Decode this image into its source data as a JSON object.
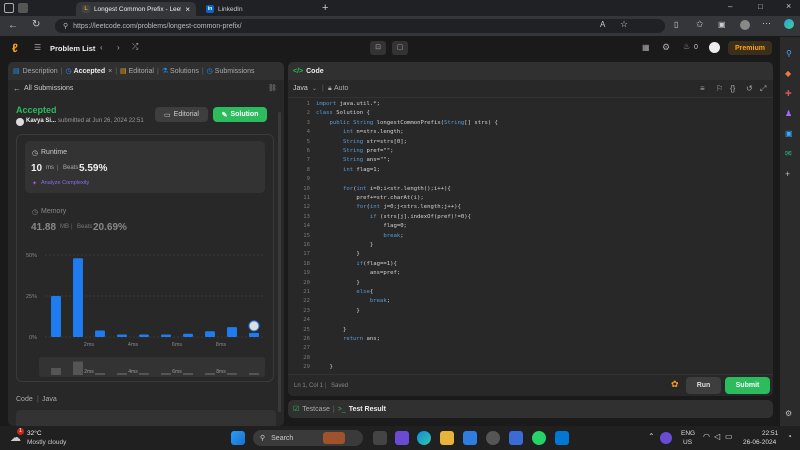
{
  "browser": {
    "tabs": [
      {
        "label": "Longest Common Prefix - LeetCo",
        "close": "×"
      },
      {
        "label": "LinkedIn"
      }
    ],
    "new_tab": "+",
    "url": "https://leetcode.com/problems/longest-common-prefix/",
    "window_controls": [
      "–",
      "□",
      "×"
    ]
  },
  "nav": {
    "problem_list": "Problem List",
    "premium": "Premium",
    "streak": "0"
  },
  "left": {
    "tabs": [
      "Description",
      "Accepted",
      "Editorial",
      "Solutions",
      "Submissions"
    ],
    "all_submissions": "All Submissions",
    "status": "Accepted",
    "user": "Kavya Si...",
    "submitted_at": "submitted at Jun 26, 2024 22:51",
    "editorial_btn": "Editorial",
    "solution_btn": "Solution",
    "runtime_title": "Runtime",
    "runtime_value": "10",
    "runtime_unit": "ms",
    "beats_label": "Beats",
    "runtime_beats": "5.59%",
    "analyze": "Analyze Complexity",
    "memory_title": "Memory",
    "memory_value": "41.88",
    "memory_unit": "MB",
    "memory_beats": "20.69%",
    "code_label": "Code",
    "lang_label": "Java"
  },
  "chart_data": {
    "type": "bar",
    "y_ticks": [
      "50%",
      "25%",
      "0%"
    ],
    "ylim": [
      0,
      50
    ],
    "x_labels": [
      "2ms",
      "4ms",
      "6ms",
      "8ms"
    ],
    "values": [
      25,
      48,
      4,
      1.5,
      1.5,
      1.5,
      2,
      3.5,
      6,
      2.5
    ],
    "bar_color": "#1e7cf0"
  },
  "code": {
    "title": "Code",
    "lang": "Java",
    "auto": "Auto",
    "lines": [
      "import java.util.*;",
      "class Solution {",
      "    public String longestCommonPrefix(String[] strs) {",
      "        int n=strs.length;",
      "        String str=strs[0];",
      "        String pref=\"\";",
      "        String ans=\"\";",
      "        int flag=1;",
      "",
      "        for(int i=0;i<str.length();i++){",
      "            pref+=str.charAt(i);",
      "            for(int j=0;j<strs.length;j++){",
      "                if (strs[j].indexOf(pref)!=0){",
      "                    flag=0;",
      "                    break;",
      "                }",
      "            }",
      "            if(flag==1){",
      "                ans=pref;",
      "            }",
      "            else{",
      "                break;",
      "            }",
      "",
      "        }",
      "        return ans;",
      "",
      "",
      "    }"
    ],
    "status_pos": "Ln 1, Col 1",
    "saved": "Saved",
    "run": "Run",
    "submit": "Submit"
  },
  "bottom": {
    "testcase": "Testcase",
    "test_result": "Test Result"
  },
  "taskbar": {
    "temp": "32°C",
    "weather": "Mostly cloudy",
    "search": "Search",
    "lang1": "ENG",
    "lang2": "US",
    "time": "22:51",
    "date": "26-06-2024",
    "notif": "1"
  },
  "colors": {
    "accent_green": "#2cbb5d",
    "accent_orange": "#ffa116",
    "bar_blue": "#1e7cf0"
  }
}
